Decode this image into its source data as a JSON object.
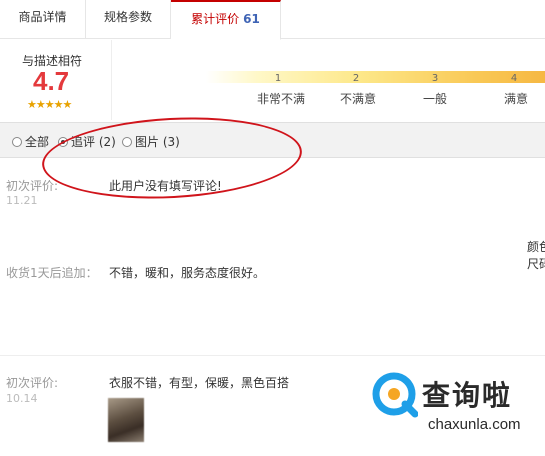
{
  "tabs": [
    {
      "label": "商品详情"
    },
    {
      "label": "规格参数"
    },
    {
      "label": "累计评价",
      "count": "61"
    }
  ],
  "rating": {
    "label": "与描述相符",
    "score": "4.7",
    "stars": "★★★★★",
    "scale": [
      {
        "num": "1",
        "label": "非常不满"
      },
      {
        "num": "2",
        "label": "不满意"
      },
      {
        "num": "3",
        "label": "一般"
      },
      {
        "num": "4",
        "label": "满意"
      }
    ]
  },
  "filter": {
    "options": [
      {
        "label": "全部",
        "selected": false
      },
      {
        "label": "追评 (2)",
        "selected": true
      },
      {
        "label": "图片 (3)",
        "selected": false
      }
    ]
  },
  "reviews": [
    {
      "first_label": "初次评价:",
      "first_date": "11.21",
      "first_text": "此用户没有填写评论!",
      "follow_label": "收货1天后追加：",
      "follow_text": "不错，暖和，服务态度很好。",
      "side_1": "颜色",
      "side_2": "尺码"
    },
    {
      "first_label": "初次评价:",
      "first_date": "10.14",
      "first_text": "衣服不错，有型，保暖，黑色百搭"
    }
  ],
  "watermark": {
    "text": "查询啦",
    "url": "chaxunla.com",
    "color": "#1e9fe8"
  },
  "colors": {
    "accent": "#c40000",
    "score": "#e4393c",
    "circle": "#d0141b"
  }
}
